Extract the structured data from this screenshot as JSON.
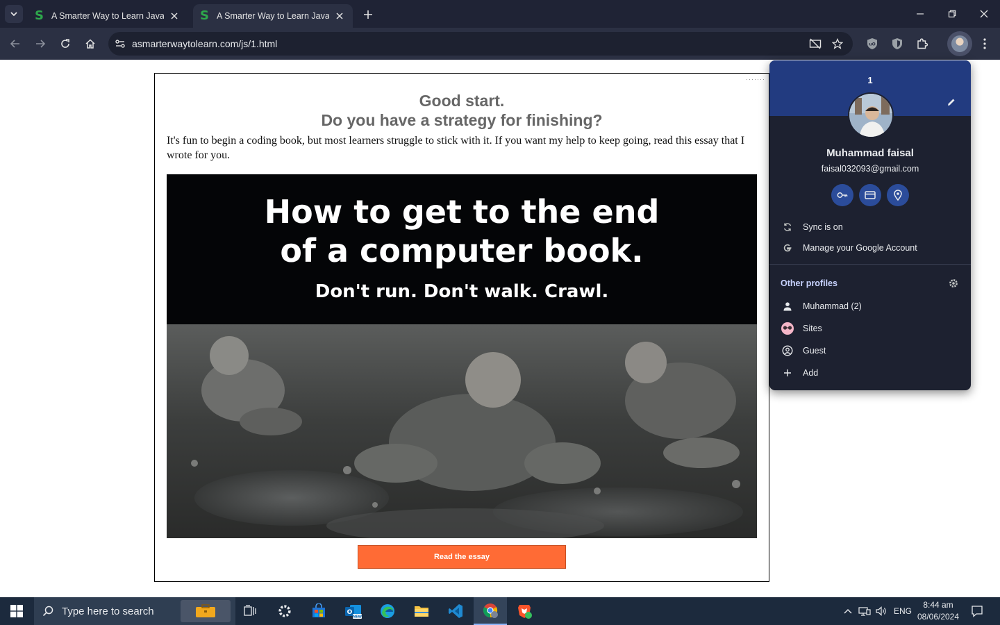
{
  "browser": {
    "tabs": [
      {
        "title": "A Smarter Way to Learn JavaScript",
        "active": false
      },
      {
        "title": "A Smarter Way to Learn JavaScript",
        "active": true
      }
    ],
    "url": "asmarterwaytolearn.com/js/1.html"
  },
  "page": {
    "headline_1": "Good start.",
    "headline_2": "Do you have a strategy for finishing?",
    "intro": "It's fun to begin a coding book, but most learners struggle to stick with it. If you want my help to keep going, read this essay that I wrote for you.",
    "banner": {
      "line_1": "How to get to the end",
      "line_2": "of a computer book.",
      "line_3": "Don't run. Don't walk. Crawl."
    },
    "cta_label": "Read the essay",
    "cta_color": "#ff6b35"
  },
  "profile": {
    "number": "1",
    "name": "Muhammad faisal",
    "email": "faisal032093@gmail.com",
    "quick_actions": [
      "key-icon",
      "credit-card-icon",
      "location-pin-icon"
    ],
    "sync_label": "Sync is on",
    "manage_label": "Manage your Google Account",
    "other_profiles_title": "Other profiles",
    "other_profiles": [
      {
        "label": "Muhammad (2)",
        "icon": "person-icon"
      },
      {
        "label": "Sites",
        "icon": "sites-avatar-icon"
      },
      {
        "label": "Guest",
        "icon": "guest-icon"
      },
      {
        "label": "Add",
        "icon": "plus-icon"
      }
    ],
    "header_color": "#223b80"
  },
  "taskbar": {
    "search_placeholder": "Type here to search",
    "language": "ENG",
    "time": "8:44 am",
    "date": "08/06/2024"
  }
}
